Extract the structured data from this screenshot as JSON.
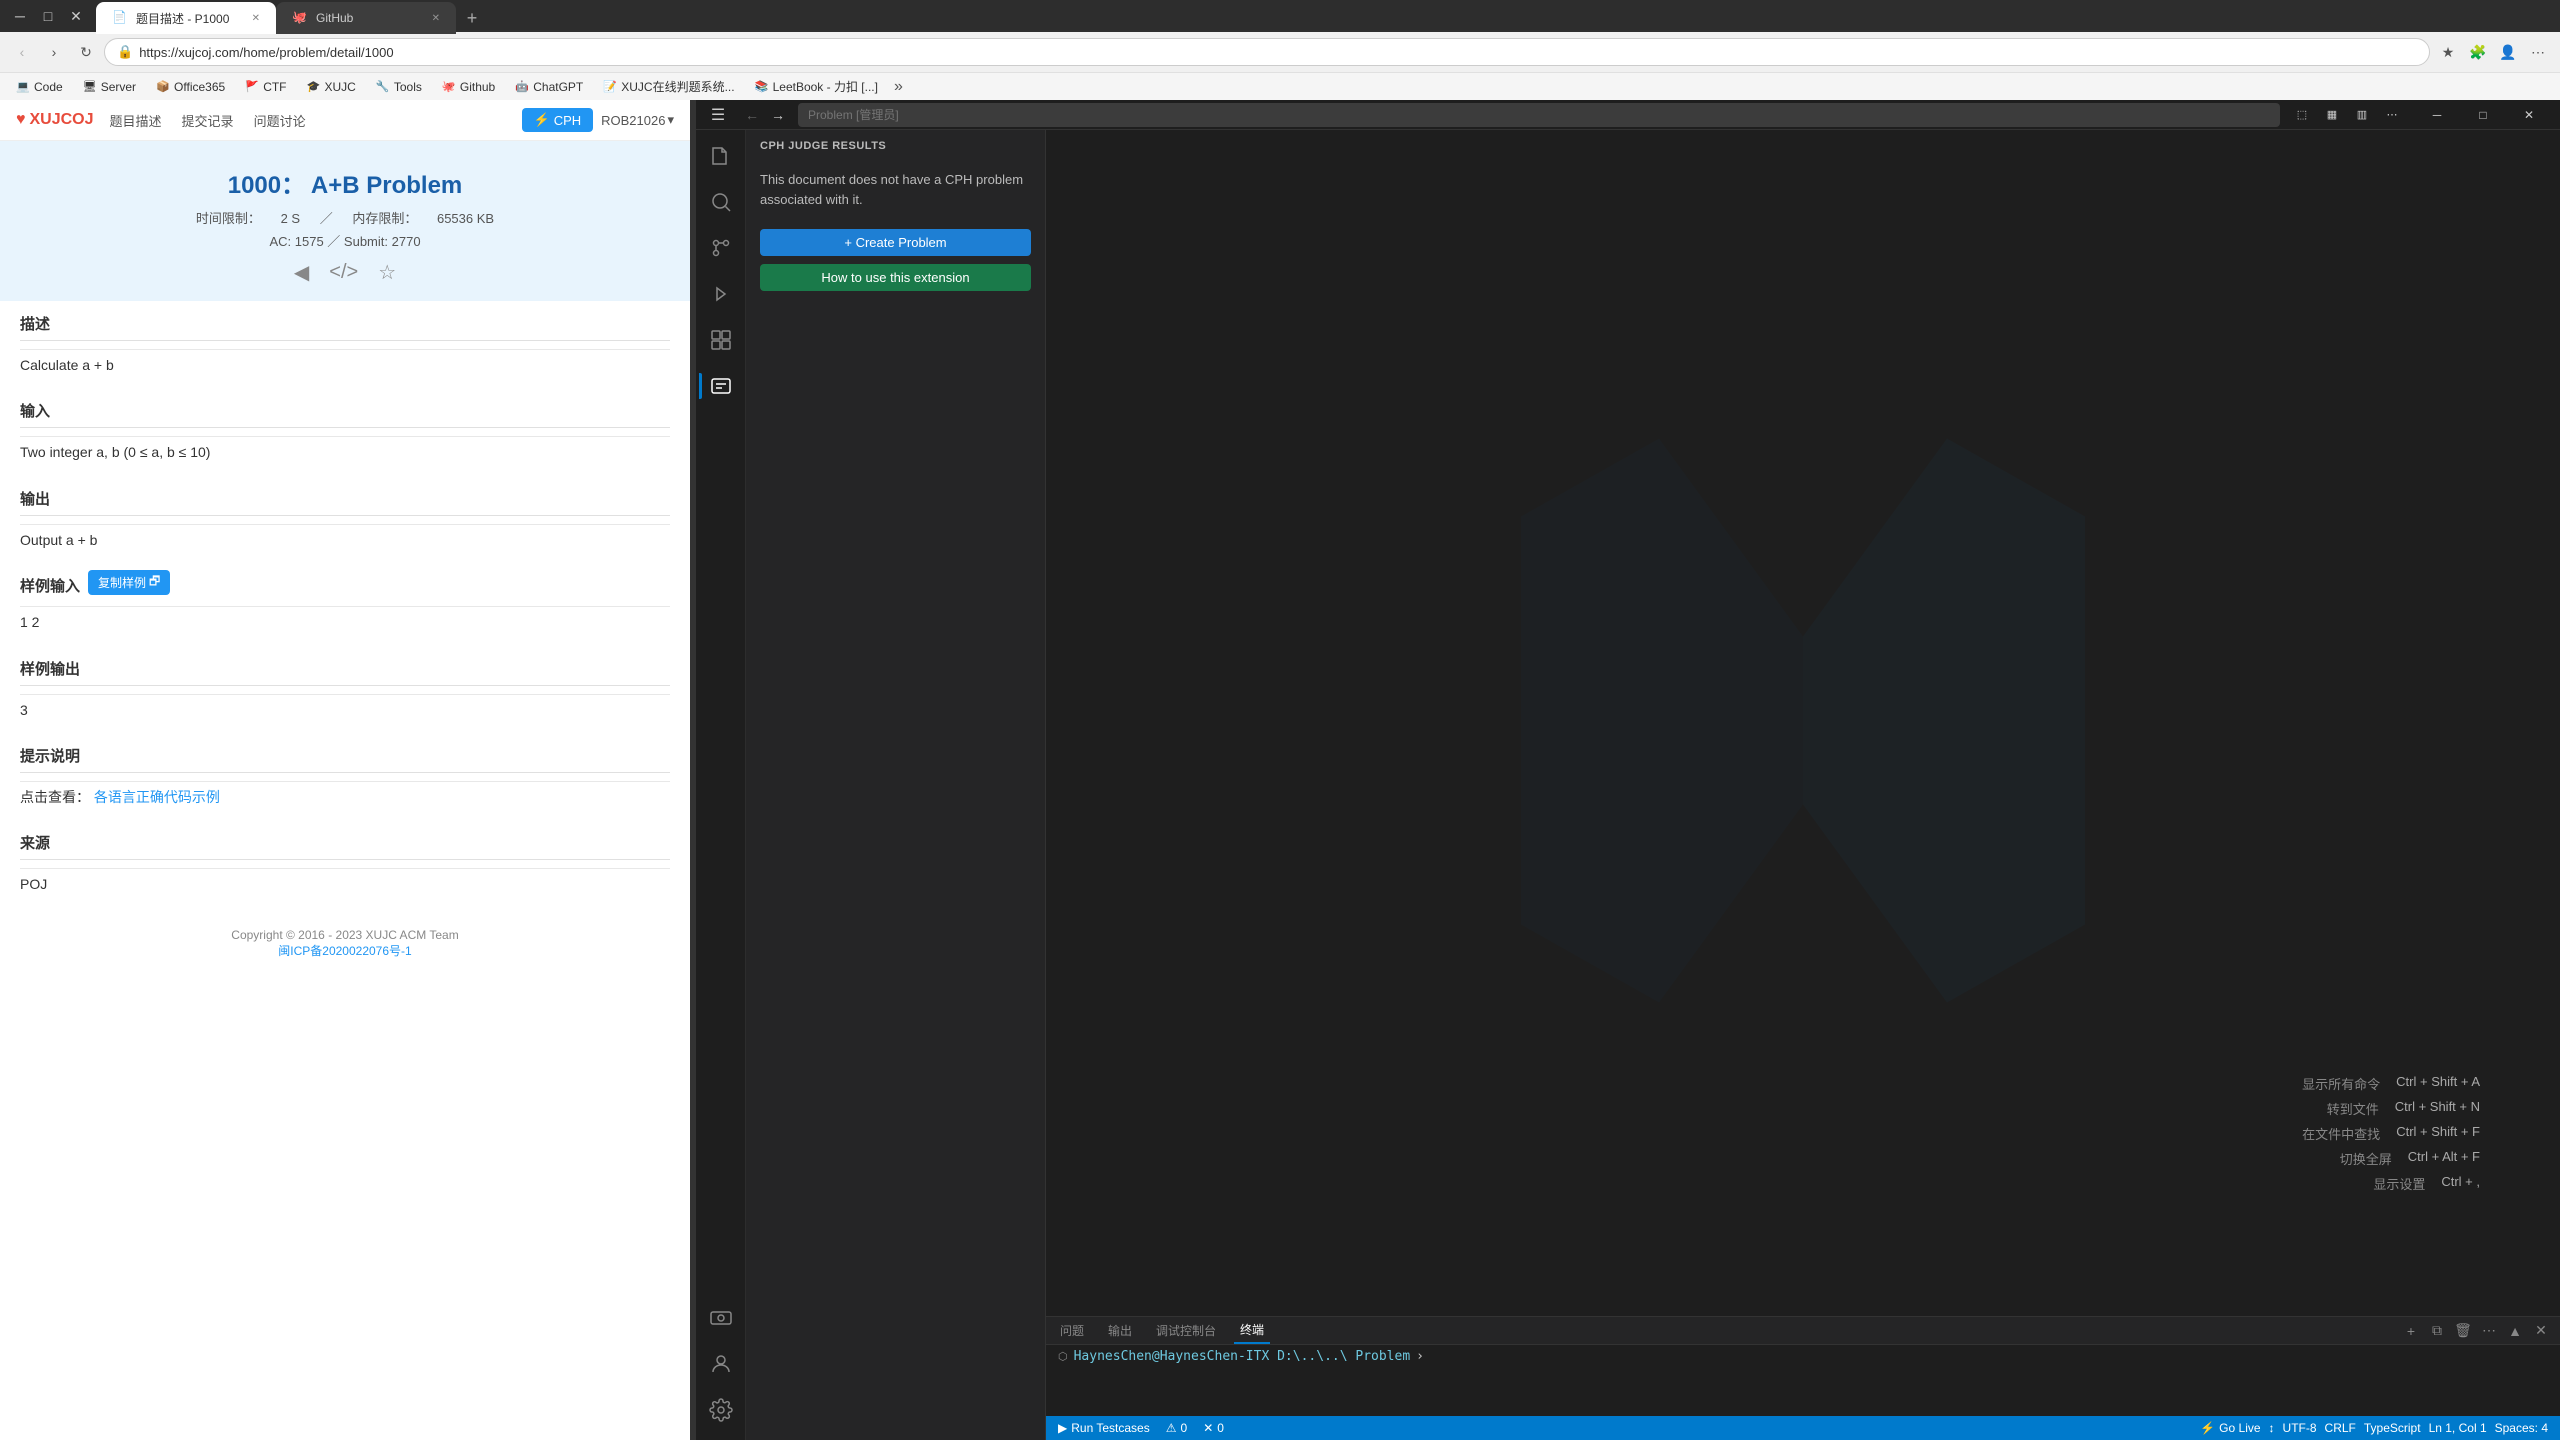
{
  "browser": {
    "tabs": [
      {
        "id": "tab1",
        "title": "题目描述 - P1000",
        "favicon": "📄",
        "active": true
      },
      {
        "id": "tab2",
        "title": "GitHub",
        "favicon": "🐙",
        "active": false
      }
    ],
    "new_tab_label": "+",
    "address": "https://xujcoj.com/home/problem/detail/1000",
    "bookmarks": [
      {
        "id": "bm1",
        "label": "Code",
        "icon": "💻"
      },
      {
        "id": "bm2",
        "label": "Server",
        "icon": "🖥"
      },
      {
        "id": "bm3",
        "label": "Office365",
        "icon": "📦"
      },
      {
        "id": "bm4",
        "label": "CTF",
        "icon": "🚩"
      },
      {
        "id": "bm5",
        "label": "XUJC",
        "icon": "🎓"
      },
      {
        "id": "bm6",
        "label": "Tools",
        "icon": "🔧"
      },
      {
        "id": "bm7",
        "label": "Github",
        "icon": "🐙"
      },
      {
        "id": "bm8",
        "label": "ChatGPT",
        "icon": "🤖"
      },
      {
        "id": "bm9",
        "label": "XUJC在线判题系统...",
        "icon": "📝"
      },
      {
        "id": "bm10",
        "label": "LeetBook - 力扣 [...]",
        "icon": "📚"
      }
    ]
  },
  "xujcoj": {
    "logo": "XUJCOJ",
    "nav_links": [
      "题目描述",
      "提交记录",
      "问题讨论"
    ],
    "cph_btn": "CPH",
    "user": "ROB21026",
    "problem": {
      "id": "1000",
      "title": "A+B Problem",
      "time_limit_label": "时间限制：",
      "time_limit": "2 S",
      "memory_limit_label": "内存限制：",
      "memory_limit": "65536 KB",
      "ac_label": "AC:",
      "ac_count": "1575",
      "submit_label": "Submit:",
      "submit_count": "2770"
    },
    "sections": {
      "description_header": "描述",
      "description": "Calculate a + b",
      "input_header": "输入",
      "input": "Two integer a, b (0 ≤ a, b ≤ 10)",
      "output_header": "输出",
      "output": "Output a + b",
      "sample_input_header": "样例输入",
      "copy_sample_btn": "复制样例",
      "sample_input": "1 2",
      "sample_output_header": "样例输出",
      "sample_output": "3",
      "hint_header": "提示说明",
      "hint_prefix": "点击查看：",
      "hint_link": "各语言正确代码示例",
      "source_header": "来源",
      "source": "POJ"
    },
    "footer": {
      "copyright": "Copyright © 2016 - 2023 XUJC ACM Team",
      "icp": "闽ICP备2020022076号-1"
    }
  },
  "vscode": {
    "title": "Problem [管理员]",
    "menu_icon": "☰",
    "nav_back": "←",
    "nav_forward": "→",
    "cph_panel": {
      "title": "CPH JUDGE RESULTS",
      "no_problem_msg": "This document does not have a CPH problem associated with it.",
      "create_btn": "+ Create Problem",
      "howto_btn": "How to use this extension"
    },
    "shortcuts": [
      {
        "label": "显示所有命令",
        "keys": "Ctrl + Shift + A"
      },
      {
        "label": "转到文件",
        "keys": "Ctrl + Shift + N"
      },
      {
        "label": "在文件中查找",
        "keys": "Ctrl + Shift + F"
      },
      {
        "label": "切换全屏",
        "keys": "Ctrl + Alt + F"
      },
      {
        "label": "显示设置",
        "keys": "Ctrl + ,"
      }
    ],
    "terminal": {
      "tabs": [
        "问题",
        "输出",
        "调试控制台",
        "终端"
      ],
      "active_tab": "终端",
      "prompt_path": "HaynesChen@HaynesChen-ITX D:\\..\\..\\ Problem",
      "new_terminal_label": "+",
      "split_label": "⧉",
      "kill_label": "🗑",
      "more_label": "...",
      "maximize_label": "▲",
      "close_label": "✕"
    },
    "statusbar": {
      "left_items": [
        "▶ Run Testcases",
        "⚠ 0",
        "✕ 0"
      ],
      "right_items": [
        "Go Live",
        "↕",
        "⚙ UTF-8",
        "CRLF",
        "TypeScript",
        "Ln 1, Col 1",
        "Spaces: 4"
      ]
    },
    "activity_bar": {
      "top_icons": [
        "files",
        "search",
        "git",
        "debug",
        "extensions",
        "cph"
      ],
      "bottom_icons": [
        "remote",
        "accounts",
        "settings"
      ]
    }
  }
}
